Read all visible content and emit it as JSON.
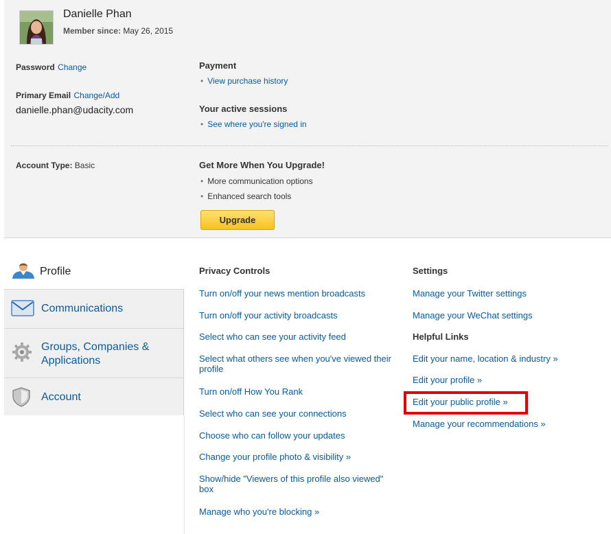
{
  "user": {
    "name": "Danielle Phan",
    "member_since_label": "Member since:",
    "member_since_value": "May 26, 2015"
  },
  "account": {
    "password_label": "Password",
    "password_link": "Change",
    "primary_email_label": "Primary Email",
    "primary_email_link": "Change/Add",
    "email": "danielle.phan@udacity.com",
    "payment_title": "Payment",
    "payment_link": "View purchase history",
    "sessions_title": "Your active sessions",
    "sessions_link": "See where you're signed in",
    "account_type_label": "Account Type:",
    "account_type_value": "Basic",
    "upgrade_title": "Get More When You Upgrade!",
    "upgrade_items": [
      "More communication options",
      "Enhanced search tools"
    ],
    "upgrade_button": "Upgrade",
    "bullet": "•"
  },
  "tabs": [
    {
      "label": "Profile",
      "icon": "profile-person-icon",
      "active": true
    },
    {
      "label": "Communications",
      "icon": "envelope-icon",
      "active": false
    },
    {
      "label": "Groups, Companies & Applications",
      "icon": "gear-icon",
      "active": false
    },
    {
      "label": "Account",
      "icon": "shield-icon",
      "active": false
    }
  ],
  "privacy": {
    "title": "Privacy Controls",
    "links": [
      "Turn on/off your news mention broadcasts",
      "Turn on/off your activity broadcasts",
      "Select who can see your activity feed",
      "Select what others see when you've viewed their profile",
      "Turn on/off How You Rank",
      "Select who can see your connections",
      "Choose who can follow your updates",
      "Change your profile photo & visibility »",
      "Show/hide \"Viewers of this profile also viewed\" box",
      "Manage who you're blocking »"
    ]
  },
  "settings": {
    "title": "Settings",
    "links": [
      "Manage your Twitter settings",
      "Manage your WeChat settings"
    ],
    "helpful_title": "Helpful Links",
    "helpful_links": [
      "Edit your name, location & industry »",
      "Edit your profile »",
      "Edit your public profile »",
      "Manage your recommendations »"
    ]
  },
  "colors": {
    "link": "#0a5aa0",
    "upgrade_button": "#f7c21c",
    "highlight": "#e0000b",
    "panel_bg": "#f3f3f3"
  }
}
